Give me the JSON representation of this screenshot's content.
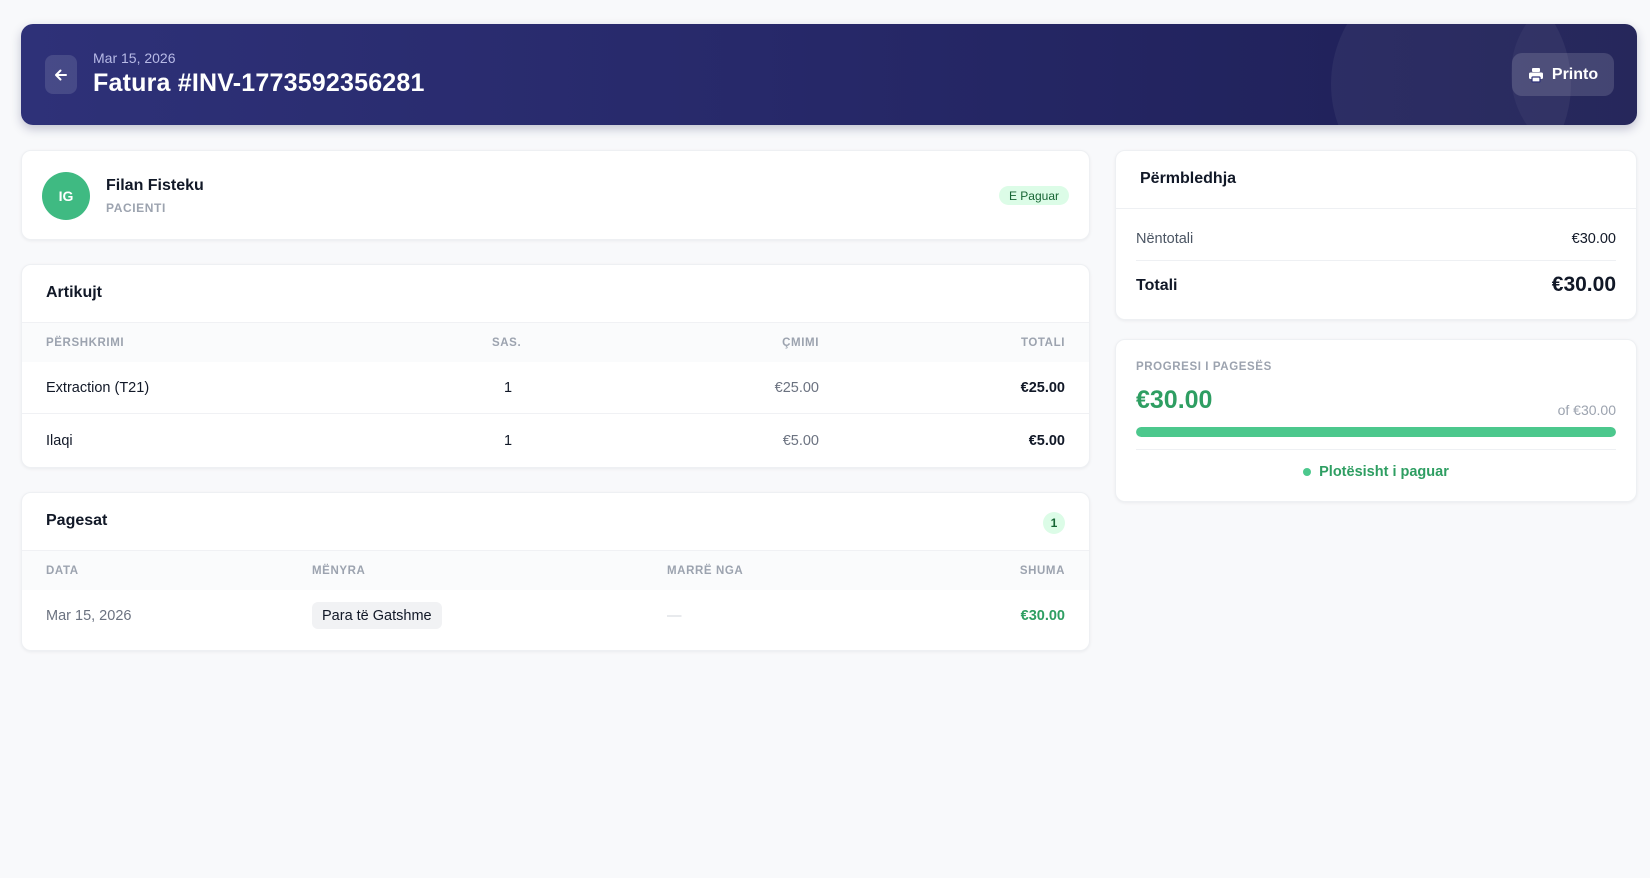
{
  "header": {
    "date": "Mar 15, 2026",
    "title": "Fatura #INV-1773592356281",
    "print_label": "Printo"
  },
  "patient": {
    "initials": "IG",
    "name": "Filan Fisteku",
    "role": "PACIENTI",
    "status": "E Paguar"
  },
  "items": {
    "title": "Artikujt",
    "columns": [
      "PËRSHKRIMI",
      "SAS.",
      "ÇMIMI",
      "TOTALI"
    ],
    "rows": [
      {
        "description": "Extraction (T21)",
        "qty": "1",
        "price": "€25.00",
        "total": "€25.00"
      },
      {
        "description": "Ilaqi",
        "qty": "1",
        "price": "€5.00",
        "total": "€5.00"
      }
    ]
  },
  "payments": {
    "title": "Pagesat",
    "count": "1",
    "columns": [
      "DATA",
      "MËNYRA",
      "MARRË NGA",
      "SHUMA"
    ],
    "rows": [
      {
        "date": "Mar 15, 2026",
        "method": "Para të Gatshme",
        "received_by": "—",
        "amount": "€30.00"
      }
    ]
  },
  "summary": {
    "title": "Përmbledhja",
    "subtotal_label": "Nëntotali",
    "subtotal_value": "€30.00",
    "total_label": "Totali",
    "total_value": "€30.00"
  },
  "progress": {
    "label": "PROGRESI I PAGESËS",
    "paid": "€30.00",
    "of_total": "of €30.00",
    "percent": 100,
    "status": "Plotësisht i paguar"
  },
  "colors": {
    "header_bg": "#2e3178",
    "accent_green": "#2e9e62",
    "progress_fill": "#4cc88d",
    "badge_bg": "#dcfce7"
  }
}
